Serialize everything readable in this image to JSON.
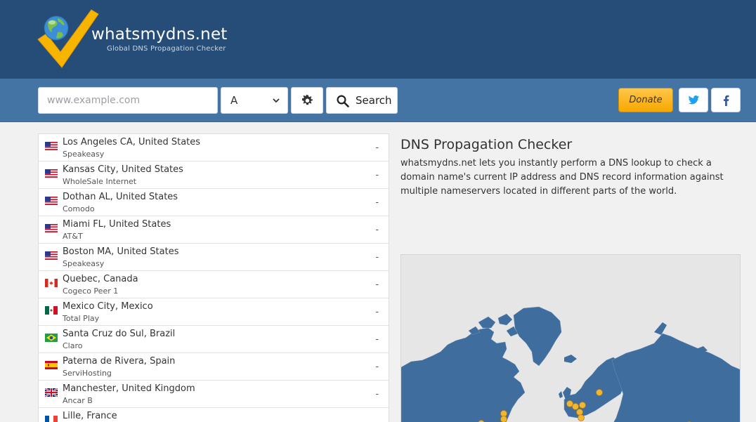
{
  "header": {
    "brand": "whatsmydns.net",
    "tagline": "Global DNS Propagation Checker"
  },
  "toolbar": {
    "domain_placeholder": "www.example.com",
    "record_type": "A",
    "search_label": "Search",
    "donate_label": "Donate"
  },
  "servers": [
    {
      "location": "Los Angeles CA, United States",
      "provider": "Speakeasy",
      "country": "us",
      "result": "-"
    },
    {
      "location": "Kansas City, United States",
      "provider": "WholeSale Internet",
      "country": "us",
      "result": "-"
    },
    {
      "location": "Dothan AL, United States",
      "provider": "Comodo",
      "country": "us",
      "result": "-"
    },
    {
      "location": "Miami FL, United States",
      "provider": "AT&T",
      "country": "us",
      "result": "-"
    },
    {
      "location": "Boston MA, United States",
      "provider": "Speakeasy",
      "country": "us",
      "result": "-"
    },
    {
      "location": "Quebec, Canada",
      "provider": "Cogeco Peer 1",
      "country": "ca",
      "result": "-"
    },
    {
      "location": "Mexico City, Mexico",
      "provider": "Total Play",
      "country": "mx",
      "result": "-"
    },
    {
      "location": "Santa Cruz do Sul, Brazil",
      "provider": "Claro",
      "country": "br",
      "result": "-"
    },
    {
      "location": "Paterna de Rivera, Spain",
      "provider": "ServiHosting",
      "country": "es",
      "result": "-"
    },
    {
      "location": "Manchester, United Kingdom",
      "provider": "Ancar B",
      "country": "gb",
      "result": "-"
    },
    {
      "location": "Lille, France",
      "provider": "",
      "country": "fr",
      "result": ""
    }
  ],
  "content": {
    "title": "DNS Propagation Checker",
    "intro": "whatsmydns.net lets you instantly perform a DNS lookup to check a domain name's current IP address and DNS record information against multiple nameservers located in different parts of the world."
  },
  "colors": {
    "header_bg": "#264d78",
    "toolbar_bg": "#4474a4",
    "donate": "#f7a800",
    "map_land": "#3f6d9e",
    "map_marker": "#f2b632"
  }
}
